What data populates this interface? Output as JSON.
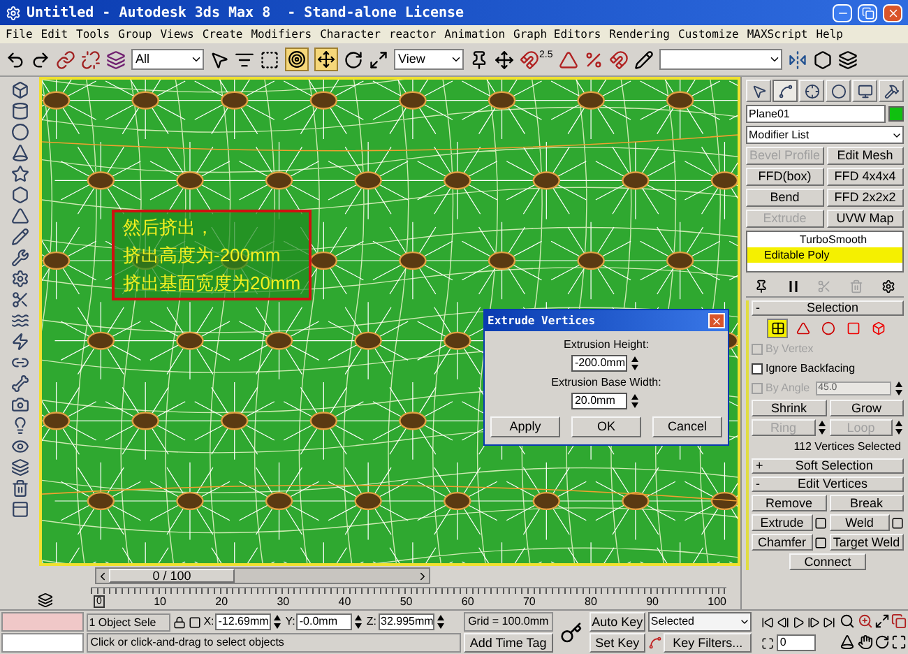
{
  "window": {
    "title": "Untitled - Autodesk 3ds Max 8  - Stand-alone License"
  },
  "menu": [
    "File",
    "Edit",
    "Tools",
    "Group",
    "Views",
    "Create",
    "Modifiers",
    "Character",
    "reactor",
    "Animation",
    "Graph Editors",
    "Rendering",
    "Customize",
    "MAXScript",
    "Help"
  ],
  "toolbar": {
    "selection_filter": "All",
    "reference_coord": "View",
    "snap_angle": "2.5"
  },
  "viewport": {
    "annotation": [
      "然后挤出，",
      "挤出高度为-200mm",
      "挤出基面宽度为20mm"
    ]
  },
  "dialog": {
    "title": "Extrude Vertices",
    "fields": [
      {
        "label": "Extrusion Height:",
        "value": "-200.0mm"
      },
      {
        "label": "Extrusion Base Width:",
        "value": "20.0mm"
      }
    ],
    "buttons": [
      "Apply",
      "OK",
      "Cancel"
    ]
  },
  "command_panel": {
    "tabs": [
      {
        "selected": false
      },
      {
        "selected": true
      },
      {
        "selected": false
      },
      {
        "selected": false
      },
      {
        "selected": false
      },
      {
        "selected": false
      }
    ],
    "object_name": "Plane01",
    "modifier_list": "Modifier List",
    "modifier_buttons": [
      {
        "label": "Bevel Profile",
        "disabled": true
      },
      {
        "label": "Edit Mesh",
        "disabled": false
      },
      {
        "label": "FFD(box)",
        "disabled": false
      },
      {
        "label": "FFD 4x4x4",
        "disabled": false
      },
      {
        "label": "Bend",
        "disabled": false
      },
      {
        "label": "FFD 2x2x2",
        "disabled": false
      },
      {
        "label": "Extrude",
        "disabled": true
      },
      {
        "label": "UVW Map",
        "disabled": false
      }
    ],
    "stack": [
      {
        "label": "TurboSmooth",
        "selected": false
      },
      {
        "label": "Editable Poly",
        "selected": true
      }
    ],
    "selection": {
      "toggle": "-",
      "title": "Selection",
      "subobject_levels": [
        {
          "selected": true
        },
        {
          "selected": false
        },
        {
          "selected": false
        },
        {
          "selected": false
        },
        {
          "selected": false
        }
      ],
      "options": [
        {
          "label": "By Vertex",
          "checked": false,
          "disabled": true
        },
        {
          "label": "Ignore Backfacing",
          "checked": false,
          "disabled": false
        },
        {
          "label": "By Angle",
          "checked": false,
          "disabled": true,
          "value": "45.0"
        }
      ],
      "buttons": [
        {
          "label": "Shrink",
          "disabled": false,
          "spinner": false
        },
        {
          "label": "Grow",
          "disabled": false,
          "spinner": false
        },
        {
          "label": "Ring",
          "disabled": true,
          "spinner": true
        },
        {
          "label": "Loop",
          "disabled": true,
          "spinner": true
        }
      ],
      "status": "112 Vertices Selected"
    },
    "rollouts": [
      {
        "toggle": "+",
        "title": "Soft Selection"
      },
      {
        "toggle": "-",
        "title": "Edit Vertices",
        "buttons": [
          {
            "label": "Remove",
            "settings": false
          },
          {
            "label": "Break",
            "settings": false
          },
          {
            "label": "Extrude",
            "settings": true
          },
          {
            "label": "Weld",
            "settings": true
          },
          {
            "label": "Chamfer",
            "settings": true
          },
          {
            "label": "Target Weld",
            "settings": false
          },
          {
            "label": "Connect",
            "settings": false
          }
        ]
      }
    ]
  },
  "time_slider": {
    "label": "0 / 100"
  },
  "track": {
    "start": "0",
    "ticks": [
      "10",
      "20",
      "30",
      "40",
      "50",
      "60",
      "70",
      "80",
      "90",
      "100"
    ]
  },
  "status": {
    "selection": "1 Object Sele",
    "coords": [
      {
        "axis": "X:",
        "value": "-12.69mm"
      },
      {
        "axis": "Y:",
        "value": "-0.0mm"
      },
      {
        "axis": "Z:",
        "value": "32.995mm"
      }
    ],
    "grid": "Grid = 100.0mm",
    "prompt": "Click or click-and-drag to select objects",
    "time_tag": "Add Time Tag",
    "auto_key": "Auto Key",
    "key_mode": "Selected",
    "set_key": "Set Key",
    "key_filters": "Key Filters...",
    "frame": "0"
  }
}
